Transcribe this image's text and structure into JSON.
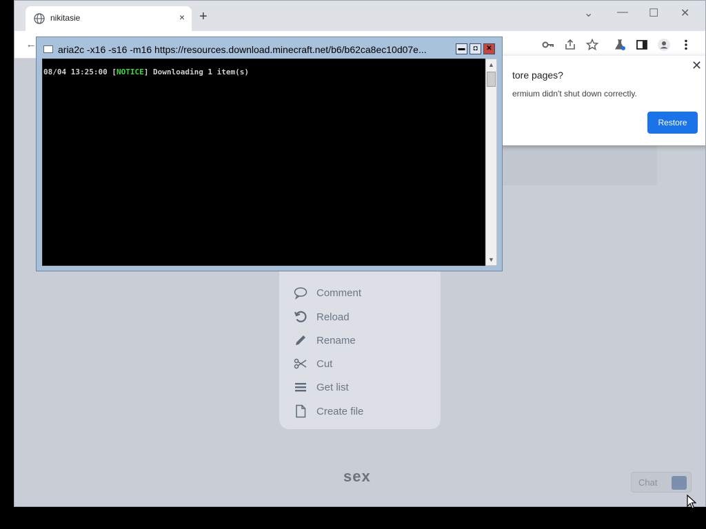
{
  "browser": {
    "tab": {
      "title": "nikitasie",
      "close": "×"
    },
    "newtab": "+",
    "window_controls": [
      "⌄",
      "—",
      "☐",
      "✕"
    ],
    "toolbar_icons": [
      "key-icon",
      "share-icon",
      "star-icon",
      "flask-icon",
      "sidepanel-icon",
      "profile-icon",
      "menu-icon"
    ]
  },
  "restore_popup": {
    "title": "tore pages?",
    "text": "ermium didn't shut down correctly.",
    "close": "✕",
    "button": "Restore"
  },
  "console": {
    "title": "aria2c  -x16 -s16 -m16 https://resources.download.minecraft.net/b6/b62ca8ec10d07e...",
    "line_prefix": "08/04 13:25:00 [",
    "line_notice": "NOTICE",
    "line_suffix": "] Downloading 1 item(s)",
    "buttons": {
      "minimize": "▬",
      "maximize": "◘",
      "close": "✕"
    }
  },
  "context_menu": {
    "items": [
      {
        "label": "Comment",
        "icon": "comment-icon"
      },
      {
        "label": "Reload",
        "icon": "reload-icon"
      },
      {
        "label": "Rename",
        "icon": "pencil-icon"
      },
      {
        "label": "Cut",
        "icon": "scissors-icon"
      },
      {
        "label": "Get list",
        "icon": "list-icon"
      },
      {
        "label": "Create file",
        "icon": "file-icon"
      }
    ]
  },
  "page": {
    "brand": "sex",
    "chat_label": "Chat"
  },
  "colors": {
    "restore_button": "#1a73e8",
    "notice_text": "#3fd83f",
    "console_bg": "#000000"
  }
}
